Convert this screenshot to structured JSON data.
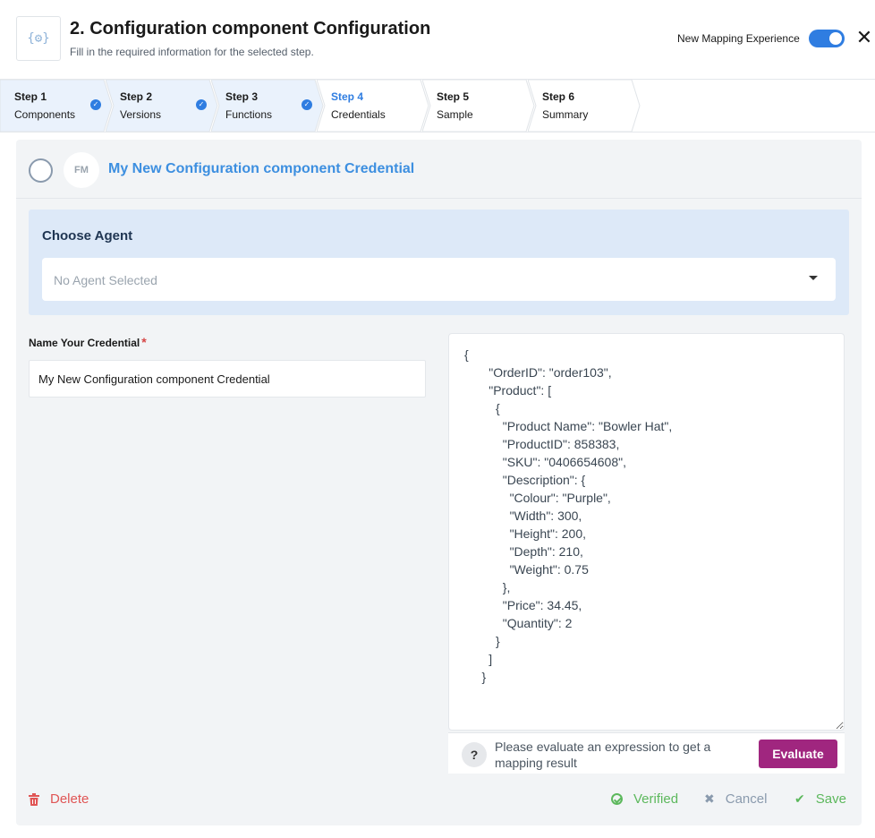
{
  "header": {
    "logo_glyph": "{⚙}",
    "title": "2. Configuration component Configuration",
    "subtitle": "Fill in the required information for the selected step.",
    "toggle_label": "New Mapping Experience",
    "toggle_on": true,
    "close_glyph": "✕"
  },
  "steps": [
    {
      "num": "Step 1",
      "name": "Components",
      "done": true
    },
    {
      "num": "Step 2",
      "name": "Versions",
      "done": true
    },
    {
      "num": "Step 3",
      "name": "Functions",
      "done": true
    },
    {
      "num": "Step 4",
      "name": "Credentials",
      "active": true
    },
    {
      "num": "Step 5",
      "name": "Sample"
    },
    {
      "num": "Step 6",
      "name": "Summary"
    }
  ],
  "credential": {
    "avatar": "FM",
    "title": "My New Configuration component Credential"
  },
  "agent": {
    "label": "Choose Agent",
    "placeholder": "No Agent Selected"
  },
  "name_field": {
    "label": "Name Your Credential",
    "required_mark": "*",
    "value": "My New Configuration component Credential"
  },
  "editor": {
    "content": "{\n       \"OrderID\": \"order103\",\n       \"Product\": [\n         {\n           \"Product Name\": \"Bowler Hat\",\n           \"ProductID\": 858383,\n           \"SKU\": \"0406654608\",\n           \"Description\": {\n             \"Colour\": \"Purple\",\n             \"Width\": 300,\n             \"Height\": 200,\n             \"Depth\": 210,\n             \"Weight\": 0.75\n           },\n           \"Price\": 34.45,\n           \"Quantity\": 2\n         }\n       ]\n     }",
    "help_glyph": "?",
    "help_text": "Please evaluate an expression to get a mapping result",
    "evaluate_label": "Evaluate"
  },
  "actions": {
    "delete_label": "Delete",
    "verified_label": "Verified",
    "cancel_label": "Cancel",
    "save_label": "Save"
  },
  "colors": {
    "accent": "#2f7de1",
    "evaluate": "#a0267f",
    "danger": "#e05555",
    "success": "#5cb85c"
  }
}
